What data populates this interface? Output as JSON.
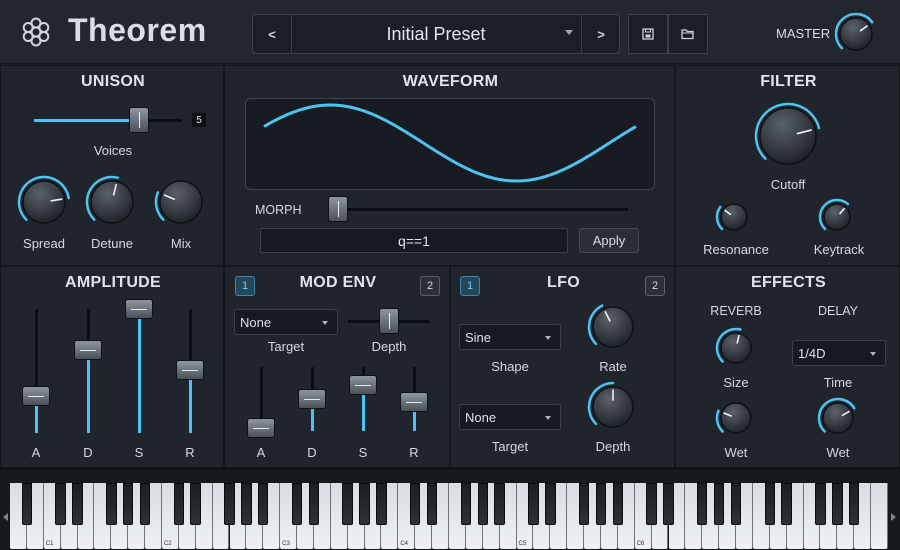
{
  "app": {
    "title": "Theorem"
  },
  "preset": {
    "name": "Initial Preset",
    "prev_label": "<",
    "next_label": ">"
  },
  "master": {
    "label": "MASTER",
    "value": 0.7
  },
  "unison": {
    "title": "UNISON",
    "voices": {
      "label": "Voices",
      "value": "5",
      "fraction": 0.71
    },
    "knobs": [
      {
        "label": "Spread",
        "value": 0.8
      },
      {
        "label": "Detune",
        "value": 0.55
      },
      {
        "label": "Mix",
        "value": 0.25
      }
    ]
  },
  "waveform": {
    "title": "WAVEFORM",
    "morph_label": "MORPH",
    "morph_value": 0.02,
    "expression": "q==1",
    "apply_label": "Apply"
  },
  "filter": {
    "title": "FILTER",
    "knobs": [
      {
        "label": "Cutoff",
        "value": 0.78
      },
      {
        "label": "Resonance",
        "value": 0.3
      },
      {
        "label": "Keytrack",
        "value": 0.65
      }
    ]
  },
  "amplitude": {
    "title": "AMPLITUDE",
    "sliders": [
      {
        "label": "A",
        "value": 0.3
      },
      {
        "label": "D",
        "value": 0.67
      },
      {
        "label": "S",
        "value": 1.0
      },
      {
        "label": "R",
        "value": 0.51
      }
    ]
  },
  "mod_env": {
    "title": "MOD ENV",
    "badge1": "1",
    "badge2": "2",
    "target": {
      "value": "None",
      "label": "Target"
    },
    "depth": {
      "label": "Depth",
      "value": 0.5
    },
    "sliders": [
      {
        "label": "A",
        "value": 0.05
      },
      {
        "label": "D",
        "value": 0.5
      },
      {
        "label": "S",
        "value": 0.72
      },
      {
        "label": "R",
        "value": 0.45
      }
    ]
  },
  "lfo": {
    "title": "LFO",
    "badge1": "1",
    "badge2": "2",
    "shape": {
      "value": "Sine",
      "label": "Shape"
    },
    "target": {
      "value": "None",
      "label": "Target"
    },
    "rate": {
      "label": "Rate",
      "value": 0.4
    },
    "depth": {
      "label": "Depth",
      "value": 0.5
    }
  },
  "effects": {
    "title": "EFFECTS",
    "reverb": {
      "label": "REVERB",
      "size_label": "Size",
      "size_value": 0.55,
      "wet_label": "Wet",
      "wet_value": 0.25
    },
    "delay": {
      "label": "DELAY",
      "time_value": "1/4D",
      "time_label": "Time",
      "wet_label": "Wet",
      "wet_value": 0.72
    }
  },
  "keyboard": {
    "octave_labels": [
      "C1",
      "C2",
      "C3",
      "C4",
      "C5",
      "C6"
    ]
  },
  "colors": {
    "accent": "#4fc3f0",
    "panel": "#20252d",
    "background": "#1b1f26"
  }
}
